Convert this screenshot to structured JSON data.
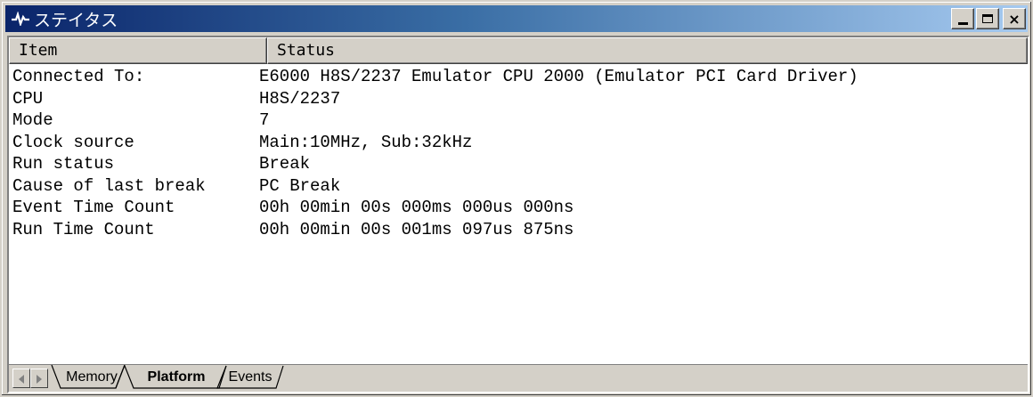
{
  "window": {
    "title": "ステイタス",
    "icon": "status-pulse-icon",
    "controls": {
      "minimize": "_",
      "maximize": "□",
      "close": "×"
    }
  },
  "table": {
    "columns": [
      "Item",
      "Status"
    ],
    "rows": [
      {
        "item": "Connected To:",
        "status": "E6000 H8S/2237 Emulator CPU 2000 (Emulator PCI Card Driver)"
      },
      {
        "item": "CPU",
        "status": "H8S/2237"
      },
      {
        "item": "Mode",
        "status": "7"
      },
      {
        "item": "Clock source",
        "status": "Main:10MHz, Sub:32kHz"
      },
      {
        "item": "Run status",
        "status": "Break"
      },
      {
        "item": "Cause of last break",
        "status": "PC Break"
      },
      {
        "item": "Event Time Count",
        "status": "00h 00min 00s 000ms 000us 000ns"
      },
      {
        "item": "Run Time Count",
        "status": "00h 00min 00s 001ms 097us 875ns"
      }
    ]
  },
  "tabs": [
    {
      "label": "Memory",
      "active": false
    },
    {
      "label": "Platform",
      "active": true
    },
    {
      "label": "Events",
      "active": false
    }
  ]
}
